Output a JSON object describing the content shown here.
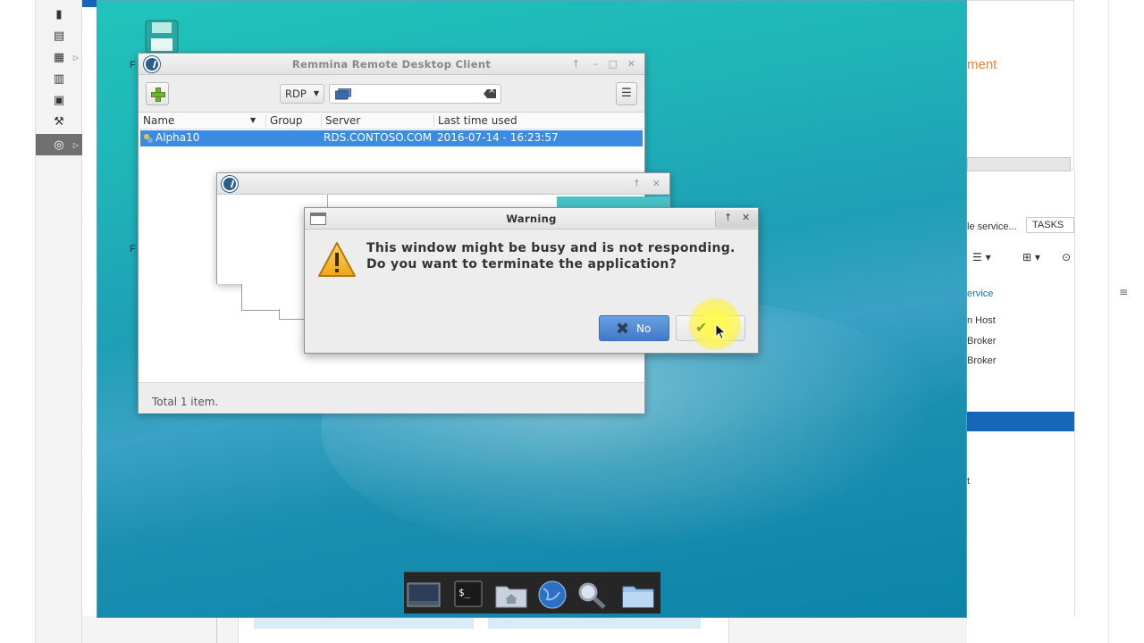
{
  "remmina": {
    "title": "Remmina Remote Desktop Client",
    "protocol": "RDP",
    "search": {
      "value": "",
      "placeholder": ""
    },
    "columns": {
      "name": "Name",
      "group": "Group",
      "server": "Server",
      "last_used": "Last time used"
    },
    "rows": [
      {
        "name": "Alpha10",
        "group": "",
        "server": "RDS.CONTOSO.COM",
        "last_used": "2016-07-14 - 16:23:57"
      }
    ],
    "status": "Total 1 item."
  },
  "warning": {
    "title": "Warning",
    "line1": "This window might be busy and is not responding.",
    "line2": "Do you want to terminate the application?",
    "no_label": "No",
    "yes_label": "es"
  },
  "host": {
    "right_heading": "ment",
    "right_desc": "le service...",
    "tasks_label": "TASKS",
    "link_text": "ervice",
    "list": [
      "n Host",
      "Broker",
      "Broker"
    ],
    "tail": "t"
  },
  "desktop": {
    "icon_label_1": "F",
    "icon_label_2": "F"
  },
  "colors": {
    "accent": "#1565b8",
    "selection": "#3b8be2",
    "warning": "#f2b21a",
    "desktop": "#1fb3b8"
  }
}
